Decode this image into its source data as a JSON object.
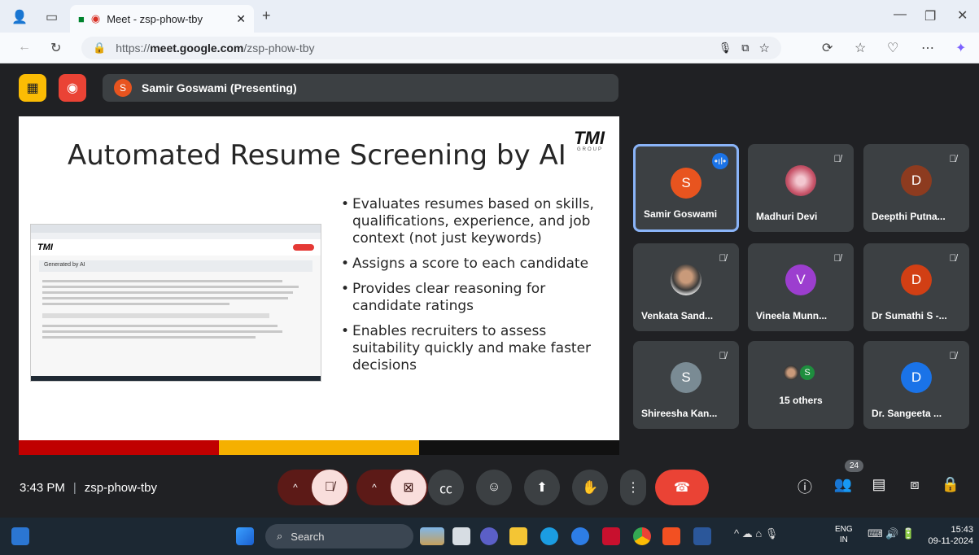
{
  "browser": {
    "tab_title": "Meet - zsp-phow-tby",
    "url_prefix": "https://",
    "url_host": "meet.google.com",
    "url_path": "/zsp-phow-tby"
  },
  "meet": {
    "presenter_initial": "S",
    "presenter_label": "Samir Goswami (Presenting)",
    "slide": {
      "title": "Automated Resume Screening by AI",
      "logo_text": "TMI",
      "logo_sub": "GROUP",
      "bullets": [
        "Evaluates resumes based on skills, qualifications, experience, and job context (not just keywords)",
        "Assigns a score to each candidate",
        "Provides clear reasoning for candidate ratings",
        "Enables recruiters to assess suitability quickly and make faster decisions"
      ],
      "mini_header": "Generated by AI",
      "mini_logo": "TMI",
      "stripe_colors": [
        "#c00000",
        "#f5b000",
        "#111111"
      ]
    },
    "participants": [
      {
        "initial": "S",
        "name": "Samir Goswami",
        "color": "#e8541f"
      },
      {
        "initial": "",
        "name": "Madhuri Devi",
        "color": "#c9566b"
      },
      {
        "initial": "D",
        "name": "Deepthi Putna...",
        "color": "#8d3b1f"
      },
      {
        "initial": "",
        "name": "Venkata Sand...",
        "color": "#9aa0a6"
      },
      {
        "initial": "V",
        "name": "Vineela Munn...",
        "color": "#9c3ecf"
      },
      {
        "initial": "D",
        "name": "Dr Sumathi S -...",
        "color": "#d23f14"
      },
      {
        "initial": "S",
        "name": "Shireesha Kan...",
        "color": "#7a8b94"
      },
      {
        "initial": "S",
        "name": "15 others",
        "color": "#1e8e3e"
      },
      {
        "initial": "D",
        "name": "Dr. Sangeeta ...",
        "color": "#1a73e8"
      }
    ],
    "time": "3:43 PM",
    "meeting_code": "zsp-phow-tby",
    "people_count": "24"
  },
  "taskbar": {
    "search_placeholder": "Search",
    "lang_top": "ENG",
    "lang_bottom": "IN",
    "clock_time": "15:43",
    "clock_date": "09-11-2024"
  },
  "colors": {
    "accent_blue": "#8ab4f8",
    "hangup": "#ea4335",
    "mic_off_bg": "#f9dedc",
    "record_red": "#ea4335",
    "present_yellow": "#fbbc04"
  }
}
